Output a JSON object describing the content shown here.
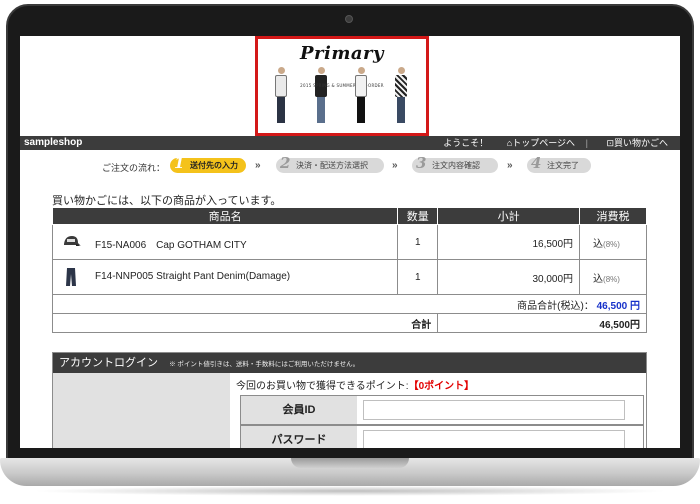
{
  "banner": {
    "title": "Primary",
    "subtitle": "2015 SPRING & SUMMER PRE-ORDER"
  },
  "shop": {
    "name": "sampleshop",
    "welcome": "ようこそ！",
    "top_link": "トップページへ",
    "cart_link": "買い物かごへ"
  },
  "steps": {
    "label": "ご注文の流れ：",
    "items": [
      {
        "num": "1",
        "label": "送付先の入力"
      },
      {
        "num": "2",
        "label": "決済・配送方法選択"
      },
      {
        "num": "3",
        "label": "注文内容確認"
      },
      {
        "num": "4",
        "label": "注文完了"
      }
    ]
  },
  "cart": {
    "intro": "買い物かごには、以下の商品が入っています。",
    "headers": {
      "name": "商品名",
      "qty": "数量",
      "subtotal": "小計",
      "tax": "消費税"
    },
    "items": [
      {
        "name": "F15-NA006　Cap GOTHAM CITY",
        "qty": "1",
        "subtotal": "16,500円",
        "tax": "込",
        "tax_rate": "(8%)",
        "icon": "cap-icon"
      },
      {
        "name": "F14-NNP005 Straight Pant Denim(Damage)",
        "qty": "1",
        "subtotal": "30,000円",
        "tax": "込",
        "tax_rate": "(8%)",
        "icon": "pants-icon"
      }
    ],
    "goods_total_label": "商品合計(税込)：",
    "goods_total_value": "46,500 円",
    "total_label": "合計",
    "total_value": "46,500円"
  },
  "login": {
    "title": "アカウントログイン",
    "note": "※ ポイント値引きは、送料・手数料にはご利用いただけません。",
    "points_text": "今回のお買い物で獲得できるポイント:",
    "points_value": "【0ポイント】",
    "member_id_label": "会員ID",
    "password_label": "パスワード"
  },
  "colors": {
    "header_bg": "#3c3c3c",
    "active_step": "#f4c21b",
    "banner_border": "#d31818",
    "total_red": "#e20000",
    "goods_total_blue": "#1631c9"
  }
}
